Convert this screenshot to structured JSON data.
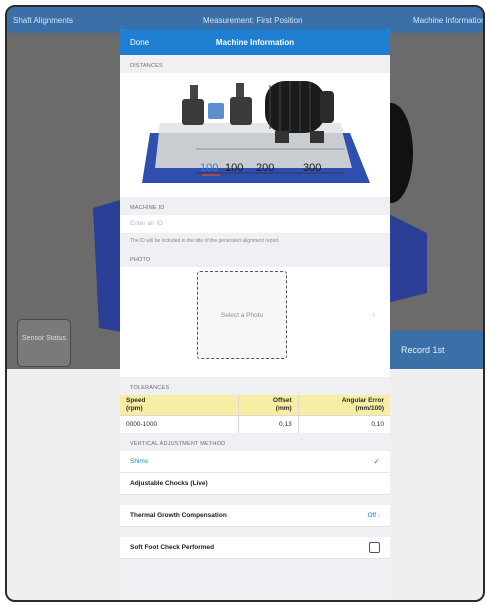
{
  "background": {
    "nav_left": "Shaft Alignments",
    "nav_middle": "Measurement: First Position",
    "nav_right": "Machine Information",
    "sensor_status_label": "Sensor Status",
    "record_button": "Record 1st"
  },
  "sheet": {
    "done_label": "Done",
    "title": "Machine Information",
    "distances_header": "DISTANCES",
    "distance_labels": [
      "100",
      "100",
      "200",
      "300"
    ],
    "machine_id_header": "MACHINE ID",
    "machine_id_placeholder": "Enter an ID",
    "machine_id_note": "The ID will be included in the title of the generated alignment report.",
    "photo_header": "PHOTO",
    "photo_placeholder": "Select a Photo",
    "tolerances_header": "TOLERANCES",
    "tolerance_columns": [
      "Speed\n(rpm)",
      "Offset\n(mm)",
      "Angular Error\n(mm/100)"
    ],
    "tolerance_row": {
      "speed": "0000-1000",
      "offset": "0,13",
      "angular": "0,10"
    },
    "vertical_header": "VERTICAL ADJUSTMENT METHOD",
    "method_shims": "Shims",
    "method_chocks": "Adjustable Chocks (Live)",
    "thermal_label": "Thermal Growth Compensation",
    "thermal_value": "Off",
    "soft_foot_label": "Soft Foot Check Performed"
  },
  "colors": {
    "accent": "#1e7fd0",
    "header_yellow": "#f7eea3",
    "machine_blue": "#2e4fb0"
  },
  "icons": [
    "chevron-right-icon",
    "checkmark-icon",
    "checkbox-icon"
  ]
}
